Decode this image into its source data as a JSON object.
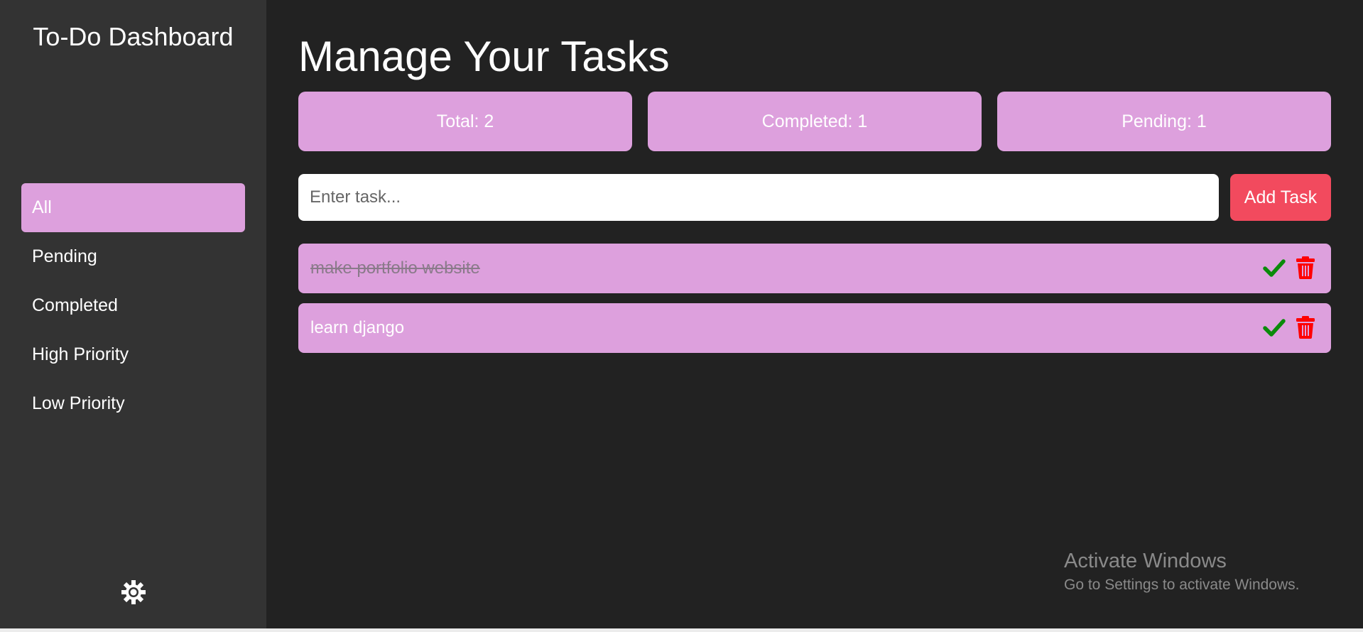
{
  "sidebar": {
    "title": "To-Do Dashboard",
    "items": [
      {
        "label": "All",
        "active": true
      },
      {
        "label": "Pending",
        "active": false
      },
      {
        "label": "Completed",
        "active": false
      },
      {
        "label": "High Priority",
        "active": false
      },
      {
        "label": "Low Priority",
        "active": false
      }
    ],
    "settings_icon": "gear-icon"
  },
  "main": {
    "title": "Manage Your Tasks",
    "stats": {
      "total": "Total: 2",
      "completed": "Completed: 1",
      "pending": "Pending: 1"
    },
    "input": {
      "value": "",
      "placeholder": "Enter task..."
    },
    "add_button": "Add Task",
    "tasks": [
      {
        "text": "make portfolio website",
        "completed": true
      },
      {
        "text": "learn django",
        "completed": false
      }
    ]
  },
  "watermark": {
    "title": "Activate Windows",
    "subtitle": "Go to Settings to activate Windows."
  },
  "colors": {
    "background": "#222222",
    "sidebar": "#333333",
    "accent": "#dda0dd",
    "add_button": "#f24a5e",
    "check": "#0a8a0a",
    "delete": "#ff0000"
  }
}
